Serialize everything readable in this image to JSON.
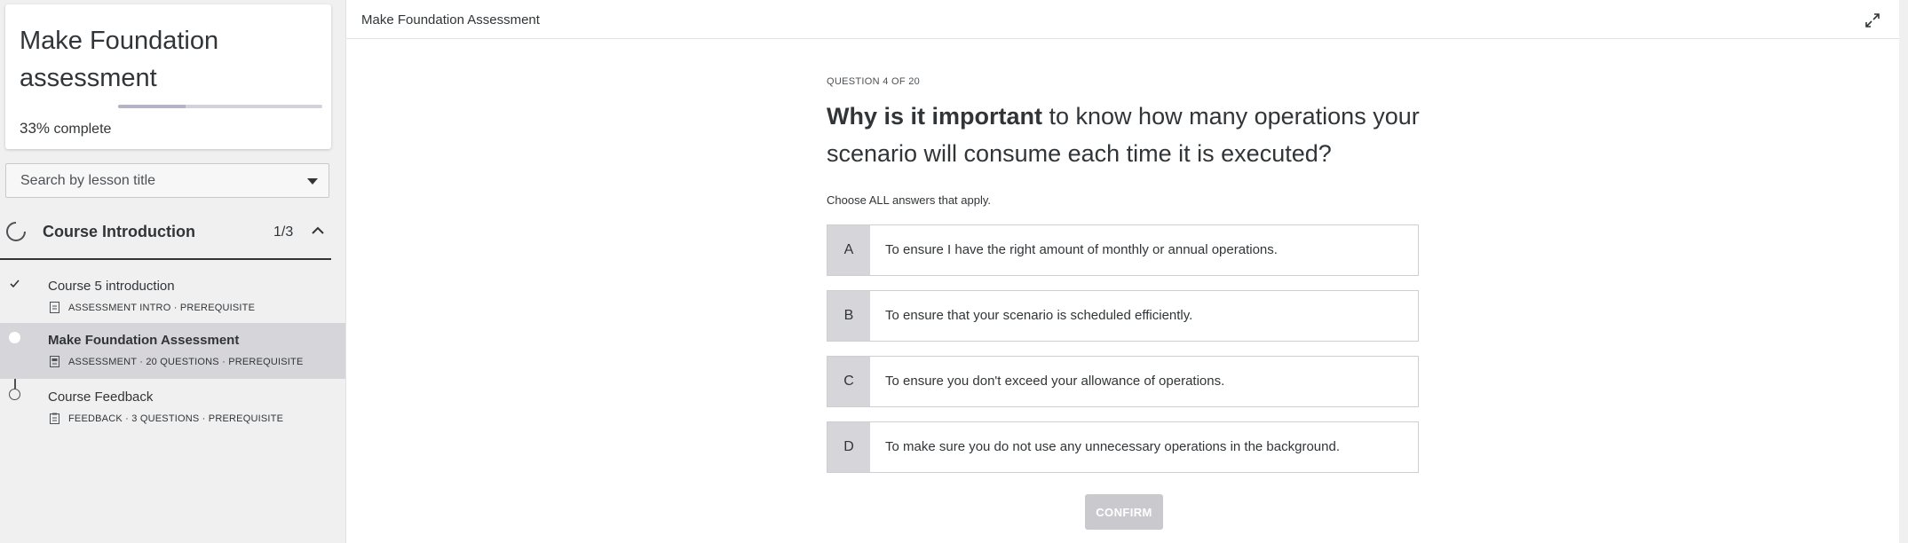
{
  "sidebar": {
    "course_title": "Make Foundation assessment",
    "progress_percent": "33%",
    "progress_suffix": "complete",
    "progress_fraction": 0.33,
    "search_placeholder": "Search by lesson title",
    "section": {
      "title": "Course Introduction",
      "count": "1/3"
    },
    "lessons": [
      {
        "title": "Course 5 introduction",
        "meta": "ASSESSMENT INTRO · PREREQUISITE",
        "status": "completed",
        "icon": "document-icon"
      },
      {
        "title": "Make Foundation Assessment",
        "meta": "ASSESSMENT · 20 QUESTIONS · PREREQUISITE",
        "status": "active",
        "icon": "assessment-icon"
      },
      {
        "title": "Course Feedback",
        "meta": "FEEDBACK · 3 QUESTIONS · PREREQUISITE",
        "status": "not-started",
        "icon": "clipboard-icon"
      }
    ]
  },
  "main": {
    "header_title": "Make Foundation Assessment",
    "question_counter": "QUESTION 4 OF 20",
    "question_strong": "Why is it important",
    "question_rest": " to know how many operations your scenario will consume each time it is executed?",
    "instruction": "Choose ALL answers that apply.",
    "answers": [
      {
        "letter": "A",
        "text": "To ensure I have the right amount of monthly or annual operations."
      },
      {
        "letter": "B",
        "text": "To ensure that your scenario is scheduled efficiently."
      },
      {
        "letter": "C",
        "text": "To ensure you don't exceed your allowance of operations."
      },
      {
        "letter": "D",
        "text": "To make sure you do not use any unnecessary operations in the background."
      }
    ],
    "confirm_label": "CONFIRM"
  },
  "colors": {
    "text": "#313537",
    "sidebar_bg": "#f0f0f1",
    "active_row": "#d6d6da",
    "letter_bg": "#d6d6da",
    "confirm_disabled": "#cacace"
  }
}
